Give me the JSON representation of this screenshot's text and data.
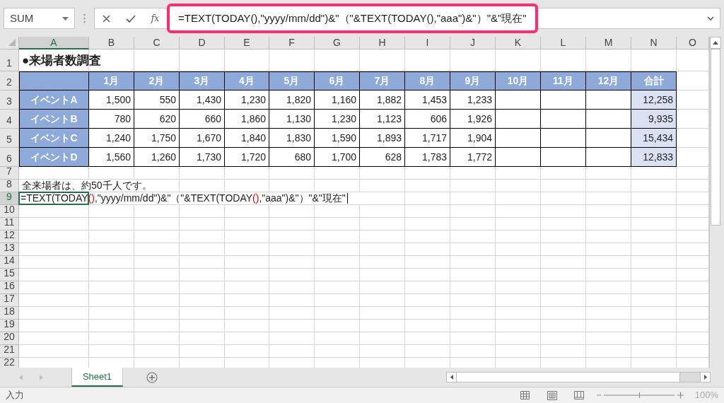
{
  "name_box": {
    "value": "SUM"
  },
  "formula_bar": {
    "function_label": "fx",
    "formula": "=TEXT(TODAY(),\"yyyy/mm/dd\")&\"（\"&TEXT(TODAY(),\"aaa\")&\"）\"&\"現在\"",
    "highlighted": true
  },
  "columns": [
    {
      "label": "A",
      "selected": true
    },
    {
      "label": "B",
      "selected": false
    },
    {
      "label": "C",
      "selected": false
    },
    {
      "label": "D",
      "selected": false
    },
    {
      "label": "E",
      "selected": false
    },
    {
      "label": "F",
      "selected": false
    },
    {
      "label": "G",
      "selected": false
    },
    {
      "label": "H",
      "selected": false
    },
    {
      "label": "I",
      "selected": false
    },
    {
      "label": "J",
      "selected": false
    },
    {
      "label": "K",
      "selected": false
    },
    {
      "label": "L",
      "selected": false
    },
    {
      "label": "M",
      "selected": false
    },
    {
      "label": "N",
      "selected": false
    },
    {
      "label": "O",
      "selected": false
    }
  ],
  "rows": [
    {
      "label": "1",
      "selected": false
    },
    {
      "label": "2",
      "selected": false
    },
    {
      "label": "3",
      "selected": false
    },
    {
      "label": "4",
      "selected": false
    },
    {
      "label": "5",
      "selected": false
    },
    {
      "label": "6",
      "selected": false
    },
    {
      "label": "7",
      "selected": false
    },
    {
      "label": "8",
      "selected": false
    },
    {
      "label": "9",
      "selected": true
    },
    {
      "label": "10",
      "selected": false
    },
    {
      "label": "11",
      "selected": false
    },
    {
      "label": "12",
      "selected": false
    },
    {
      "label": "13",
      "selected": false
    },
    {
      "label": "14",
      "selected": false
    },
    {
      "label": "15",
      "selected": false
    },
    {
      "label": "16",
      "selected": false
    },
    {
      "label": "17",
      "selected": false
    },
    {
      "label": "18",
      "selected": false
    },
    {
      "label": "19",
      "selected": false
    },
    {
      "label": "20",
      "selected": false
    },
    {
      "label": "21",
      "selected": false
    },
    {
      "label": "22",
      "selected": false
    }
  ],
  "title": "●来場者数調査",
  "table": {
    "headers": [
      "1月",
      "2月",
      "3月",
      "4月",
      "5月",
      "6月",
      "7月",
      "8月",
      "9月",
      "10月",
      "11月",
      "12月",
      "合計"
    ],
    "rows": [
      {
        "label": "イベントA",
        "values": [
          "1,500",
          "550",
          "1,430",
          "1,230",
          "1,820",
          "1,160",
          "1,882",
          "1,453",
          "1,233"
        ],
        "total": "12,258"
      },
      {
        "label": "イベントB",
        "values": [
          "780",
          "620",
          "660",
          "1,860",
          "1,130",
          "1,230",
          "1,123",
          "606",
          "1,926"
        ],
        "total": "9,935"
      },
      {
        "label": "イベントC",
        "values": [
          "1,240",
          "1,750",
          "1,670",
          "1,840",
          "1,830",
          "1,590",
          "1,893",
          "1,717",
          "1,904"
        ],
        "total": "15,434"
      },
      {
        "label": "イベントD",
        "values": [
          "1,560",
          "1,260",
          "1,730",
          "1,720",
          "680",
          "1,700",
          "628",
          "1,783",
          "1,772"
        ],
        "total": "12,833"
      }
    ]
  },
  "note": "全来場者は、約50千人です。",
  "editing": {
    "segments": [
      {
        "text": "=TEXT(TODAY",
        "kind": "plain"
      },
      {
        "text": "()",
        "kind": "paren"
      },
      {
        "text": ",\"yyyy/mm/dd\")&\"（\"&TEXT(TODAY",
        "kind": "plain"
      },
      {
        "text": "()",
        "kind": "paren"
      },
      {
        "text": ",\"aaa\")&\"）\"&\"現在\"",
        "kind": "plain"
      }
    ]
  },
  "sheet_tabs": [
    {
      "label": "Sheet1",
      "selected": true
    }
  ],
  "status_bar": {
    "mode": "入力",
    "zoom_slider": {
      "level": 0.5
    },
    "zoom": "100%"
  }
}
